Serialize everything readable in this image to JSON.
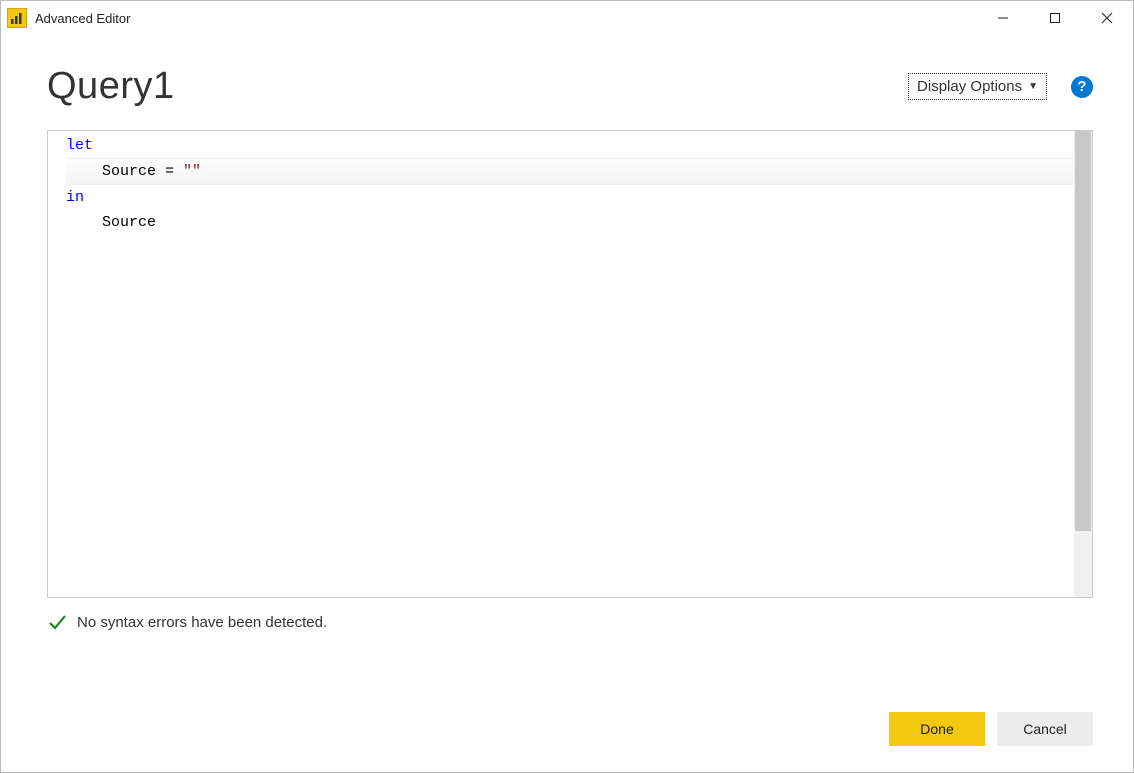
{
  "titlebar": {
    "title": "Advanced Editor"
  },
  "header": {
    "query_name": "Query1",
    "display_options_label": "Display Options",
    "help_glyph": "?"
  },
  "code": {
    "line1_kw": "let",
    "line2_indent": "    ",
    "line2_ident": "Source = ",
    "line2_str": "\"\"",
    "line3_kw": "in",
    "line4_indent": "    ",
    "line4_ident": "Source"
  },
  "status": {
    "message": "No syntax errors have been detected."
  },
  "footer": {
    "done": "Done",
    "cancel": "Cancel"
  }
}
